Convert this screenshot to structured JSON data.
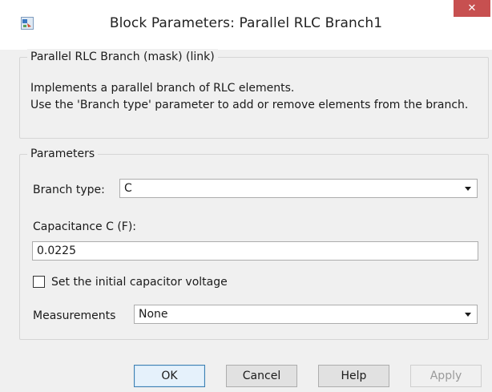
{
  "window": {
    "title": "Block Parameters: Parallel RLC Branch1",
    "close_glyph": "✕"
  },
  "mask_group": {
    "legend": "Parallel RLC Branch (mask) (link)",
    "description": "Implements a parallel branch of RLC elements.\nUse the 'Branch type' parameter to add or remove elements from the branch."
  },
  "parameters_group": {
    "legend": "Parameters",
    "branch_type": {
      "label": "Branch type:",
      "value": "C"
    },
    "capacitance": {
      "label": "Capacitance C (F):",
      "value": "0.0225"
    },
    "initial_voltage": {
      "label": "Set the initial capacitor voltage",
      "checked": false
    },
    "measurements": {
      "label": "Measurements",
      "value": "None"
    }
  },
  "buttons": {
    "ok": "OK",
    "cancel": "Cancel",
    "help": "Help",
    "apply": "Apply"
  },
  "colors": {
    "close_button": "#c75050",
    "dialog_bg": "#f0f0f0",
    "primary_border": "#3c7fb1"
  }
}
